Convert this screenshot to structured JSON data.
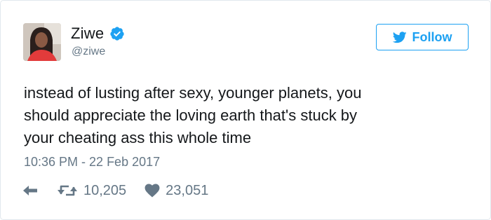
{
  "user": {
    "display_name": "Ziwe",
    "handle": "@ziwe",
    "verified": true
  },
  "follow_button": {
    "label": "Follow",
    "icon": "twitter-bird-icon"
  },
  "tweet": {
    "text": "instead of lusting after sexy, younger planets, you\nshould appreciate the loving earth that's stuck by\nyour cheating ass this whole time",
    "timestamp": "10:36 PM - 22 Feb 2017"
  },
  "actions": {
    "reply_icon": "reply-arrow-icon",
    "retweet_icon": "retweet-icon",
    "retweet_count": "10,205",
    "like_icon": "heart-icon",
    "like_count": "23,051"
  },
  "colors": {
    "accent": "#1da1f2",
    "muted": "#657786",
    "text": "#14171a",
    "border": "#e1e8ed"
  }
}
